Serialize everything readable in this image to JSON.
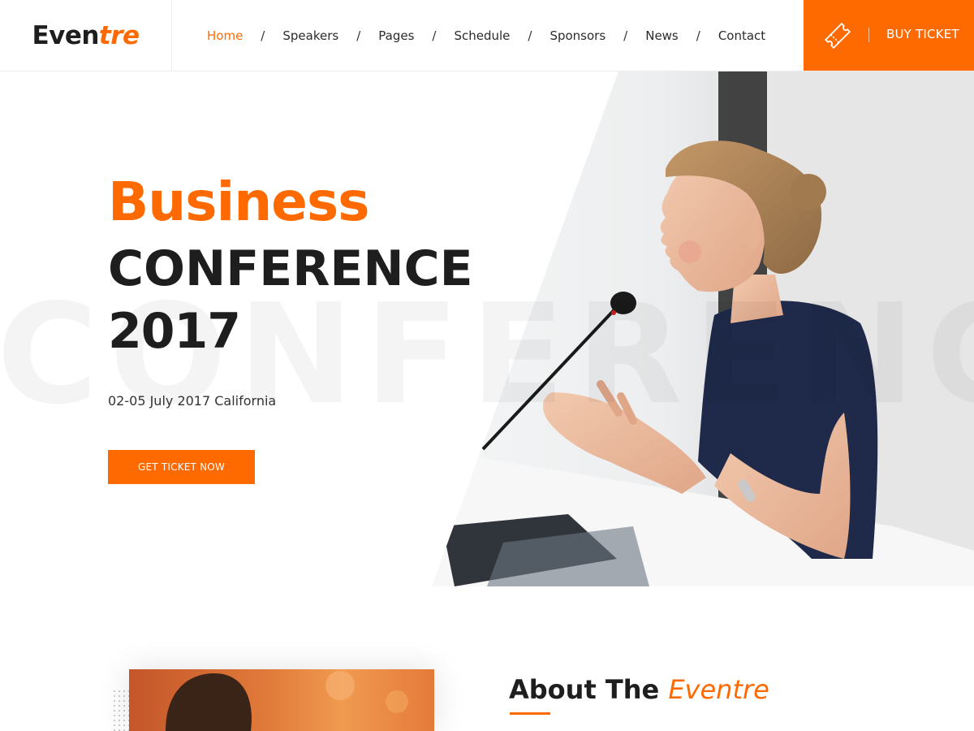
{
  "colors": {
    "accent": "#ff6a00",
    "dark": "#1e1e1e"
  },
  "header": {
    "logo_dark": "Even",
    "logo_accent": "tre",
    "nav": [
      {
        "label": "Home",
        "active": true
      },
      {
        "label": "Speakers",
        "active": false
      },
      {
        "label": "Pages",
        "active": false
      },
      {
        "label": "Schedule",
        "active": false
      },
      {
        "label": "Sponsors",
        "active": false
      },
      {
        "label": "News",
        "active": false
      },
      {
        "label": "Contact",
        "active": false
      }
    ],
    "separator": "/",
    "buy_ticket": {
      "label": "BUY TICKET",
      "icon": "ticket-icon"
    }
  },
  "hero": {
    "title_line_1": "Business",
    "title_line_2": "CONFERENCE",
    "title_line_3": "2017",
    "watermark": "CONFERENC",
    "date": "02-05 July 2017 California",
    "cta": "GET TICKET NOW"
  },
  "about": {
    "title_prefix": "About The ",
    "title_accent": "Eventre"
  }
}
